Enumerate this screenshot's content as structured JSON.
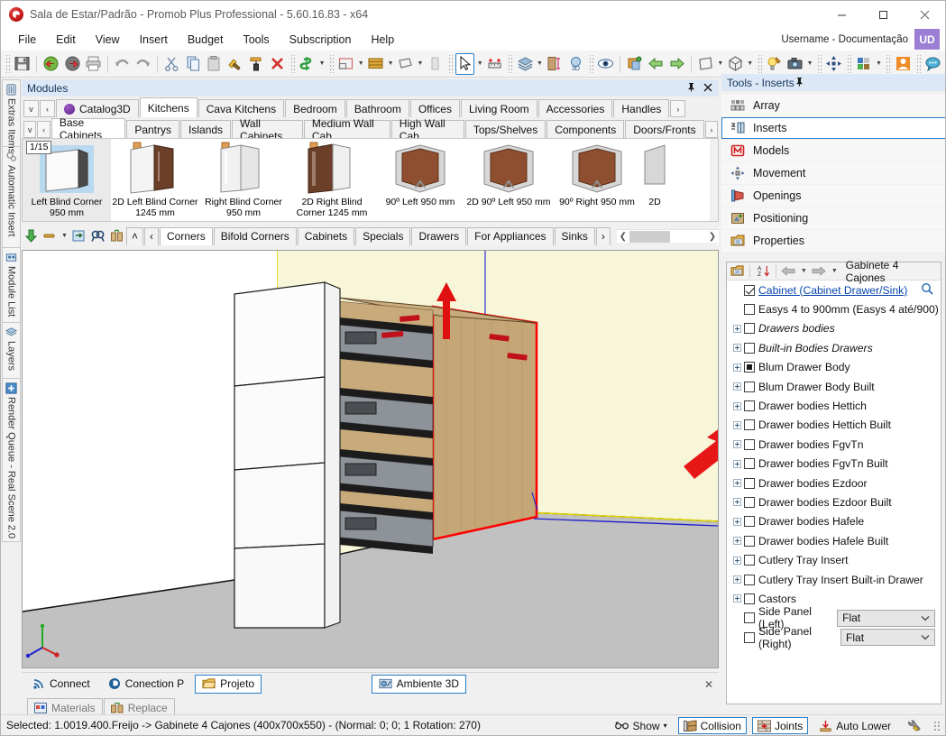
{
  "window": {
    "title": "Sala de Estar/Padrão - Promob Plus Professional - 5.60.16.83 - x64",
    "minimize": "—",
    "maximize": "☐",
    "close": "✕"
  },
  "menu": {
    "items": [
      "File",
      "Edit",
      "View",
      "Insert",
      "Budget",
      "Tools",
      "Subscription",
      "Help"
    ],
    "user_label": "Username - Documentação",
    "user_initials": "UD"
  },
  "toolbar": {
    "groups": [
      [
        "save-icon"
      ],
      [
        "import-icon",
        "export-icon",
        "print-icon"
      ],
      [
        "undo-icon",
        "redo-icon"
      ],
      [
        "cut-icon",
        "copy-icon",
        "paste-icon",
        "hammer-icon",
        "paint-roller-icon",
        "delete-icon"
      ],
      [
        "budget-money-icon"
      ],
      [
        "environment-icon",
        "wall-icon",
        "floor-icon",
        "elevation-icon"
      ],
      [
        "select-arrow-icon",
        "measure-icon"
      ],
      [
        "layers-icon",
        "door-height-icon",
        "view3d-icon"
      ],
      [
        "eye-icon",
        "render-icon",
        "prev-icon",
        "next-icon"
      ],
      [
        "perspective-icon",
        "box-view-icon"
      ],
      [
        "light-icon",
        "camera-icon"
      ],
      [
        "move-icon"
      ],
      [
        "colors-icon"
      ],
      [
        "user-icon"
      ],
      [
        "chat-icon"
      ]
    ]
  },
  "left_tabs": [
    {
      "label": "Extras Items",
      "icon": "extras-icon"
    },
    {
      "label": "Automatic Insert",
      "icon": "gears-icon"
    },
    {
      "label": "Module List",
      "icon": "module-list-icon"
    },
    {
      "label": "Layers",
      "icon": "layers-icon"
    },
    {
      "label": "Render Queue - Real Scene 2.0",
      "icon": "render-queue-icon"
    }
  ],
  "modules": {
    "caption": "Modules",
    "pin_icon": "pin-icon",
    "close_icon": "close-icon",
    "tabs_row1": {
      "dropdown": "v",
      "prev": "‹",
      "next": "›",
      "catalog": "Catalog3D",
      "items": [
        "Kitchens",
        "Cava Kitchens",
        "Bedroom",
        "Bathroom",
        "Offices",
        "Living Room",
        "Accessories",
        "Handles"
      ],
      "active": "Kitchens"
    },
    "tabs_row2": {
      "dropdown": "v",
      "prev": "‹",
      "next": "›",
      "items": [
        "Base Cabinets",
        "Pantrys",
        "Islands",
        "Wall Cabinets",
        "Medium Wall Cab",
        "High Wall Cab",
        "Tops/Shelves",
        "Components",
        "Doors/Fronts"
      ],
      "active": "Base Cabinets"
    },
    "page_badge": "1/15",
    "items": [
      {
        "label": "Left Blind Corner 950 mm",
        "type": "blind-left",
        "selected": true
      },
      {
        "label": "2D Left Blind Corner 1245 mm",
        "type": "door-left",
        "selected": false
      },
      {
        "label": "Right Blind Corner 950 mm",
        "type": "door-right",
        "selected": false
      },
      {
        "label": "2D Right Blind Corner 1245 mm",
        "type": "door-right2",
        "selected": false
      },
      {
        "label": "90º Left 950 mm",
        "type": "corner90",
        "selected": false
      },
      {
        "label": "2D 90º Left 950 mm",
        "type": "corner90",
        "selected": false
      },
      {
        "label": "90º Right 950 mm",
        "type": "corner90",
        "selected": false
      },
      {
        "label": "2D",
        "type": "partial",
        "selected": false
      }
    ],
    "bottom_tabs": {
      "items": [
        "Corners",
        "Bifold Corners",
        "Cabinets",
        "Specials",
        "Drawers",
        "For Appliances",
        "Sinks"
      ],
      "active": "Corners",
      "next": "›",
      "up": "˄",
      "prev": "‹"
    },
    "bottom_buttons": [
      "insert-module-icon",
      "line-style-icon",
      "replace-icon",
      "find-icon",
      "swap-icon"
    ]
  },
  "right_panel": {
    "caption": "Tools - Inserts",
    "pin_icon": "pin-icon",
    "tools": [
      {
        "label": "Array",
        "icon": "array-icon",
        "active": false
      },
      {
        "label": "Inserts",
        "icon": "inserts-icon",
        "active": true
      },
      {
        "label": "Models",
        "icon": "models-icon",
        "active": false
      },
      {
        "label": "Movement",
        "icon": "movement-icon",
        "active": false
      },
      {
        "label": "Openings",
        "icon": "openings-icon",
        "active": false
      },
      {
        "label": "Positioning",
        "icon": "positioning-icon",
        "active": false
      },
      {
        "label": "Properties",
        "icon": "properties-icon",
        "active": false
      }
    ],
    "tree_title": "Gabinete 4 Cajones",
    "tree_toolbar": [
      "properties-icon",
      "sort-az-icon",
      "back-arrow-icon",
      "forward-arrow-icon"
    ],
    "tree_rows": [
      {
        "label": "Cabinet (Cabinet Drawer/Sink)",
        "check": "checked",
        "expander": false,
        "style": "link",
        "search": true
      },
      {
        "label": "Easys 4 to 900mm (Easys 4 até/900)",
        "check": "empty",
        "expander": false,
        "style": "normal"
      },
      {
        "label": "Drawers bodies",
        "check": "empty",
        "expander": true,
        "style": "italic"
      },
      {
        "label": "Built-in Bodies Drawers",
        "check": "empty",
        "expander": true,
        "style": "italic"
      },
      {
        "label": "Blum Drawer Body",
        "check": "filled",
        "expander": true,
        "style": "normal"
      },
      {
        "label": "Blum Drawer Body Built",
        "check": "empty",
        "expander": true,
        "style": "normal"
      },
      {
        "label": "Drawer bodies Hettich",
        "check": "empty",
        "expander": true,
        "style": "normal"
      },
      {
        "label": "Drawer bodies Hettich Built",
        "check": "empty",
        "expander": true,
        "style": "normal"
      },
      {
        "label": "Drawer bodies FgvTn",
        "check": "empty",
        "expander": true,
        "style": "normal"
      },
      {
        "label": "Drawer bodies FgvTn Built",
        "check": "empty",
        "expander": true,
        "style": "normal"
      },
      {
        "label": "Drawer bodies Ezdoor",
        "check": "empty",
        "expander": true,
        "style": "normal"
      },
      {
        "label": "Drawer bodies Ezdoor Built",
        "check": "empty",
        "expander": true,
        "style": "normal"
      },
      {
        "label": "Drawer bodies Hafele",
        "check": "empty",
        "expander": true,
        "style": "normal"
      },
      {
        "label": "Drawer bodies Hafele Built",
        "check": "empty",
        "expander": true,
        "style": "normal"
      },
      {
        "label": "Cutlery Tray Insert",
        "check": "empty",
        "expander": true,
        "style": "normal"
      },
      {
        "label": "Cutlery Tray Insert Built-in Drawer",
        "check": "empty",
        "expander": true,
        "style": "normal"
      },
      {
        "label": "Castors",
        "check": "empty",
        "expander": true,
        "style": "normal"
      },
      {
        "label": "Side Panel (Left)",
        "check": "empty",
        "expander": false,
        "style": "normal",
        "select": "Flat"
      },
      {
        "label": "Side Panel (Right)",
        "check": "empty",
        "expander": false,
        "style": "normal",
        "select": "Flat"
      }
    ]
  },
  "bottom_tabs": {
    "items": [
      {
        "label": "Connect",
        "icon": "rss-icon",
        "boxed": false
      },
      {
        "label": "Conection P",
        "icon": "promob-icon",
        "boxed": false
      },
      {
        "label": "Projeto",
        "icon": "folder-icon",
        "boxed": true
      }
    ],
    "ambiente": {
      "label": "Ambiente 3D",
      "icon": "ambient3d-icon",
      "boxed": true
    },
    "close": "✕",
    "row2": [
      {
        "label": "Materials",
        "icon": "materials-icon"
      },
      {
        "label": "Replace",
        "icon": "replace-icon"
      }
    ]
  },
  "status": {
    "text": "Selected: 1.0019.400.Freijo -> Gabinete 4 Cajones (400x700x550) - (Normal: 0; 0; 1 Rotation: 270)",
    "buttons": [
      {
        "label": "Show",
        "icon": "glasses-icon",
        "caret": "▾",
        "boxed": false
      },
      {
        "label": "Collision",
        "icon": "collision-icon",
        "caret": "",
        "boxed": true
      },
      {
        "label": "Joints",
        "icon": "joints-icon",
        "caret": "",
        "boxed": true
      },
      {
        "label": "Auto Lower",
        "icon": "auto-lower-icon",
        "caret": "",
        "boxed": false
      },
      {
        "label": "",
        "icon": "wrench-icon",
        "caret": "",
        "boxed": false
      }
    ]
  },
  "colors": {
    "accent": "#2a7fc9",
    "caption_bg": "#dce8f5",
    "panel_bg": "#f0f0f0",
    "wall": "#f8f6d8",
    "floor": "#c1c1c1",
    "wood": "#c0a070",
    "highlight_red": "#ff0000",
    "user_badge": "#9b7fd4"
  }
}
